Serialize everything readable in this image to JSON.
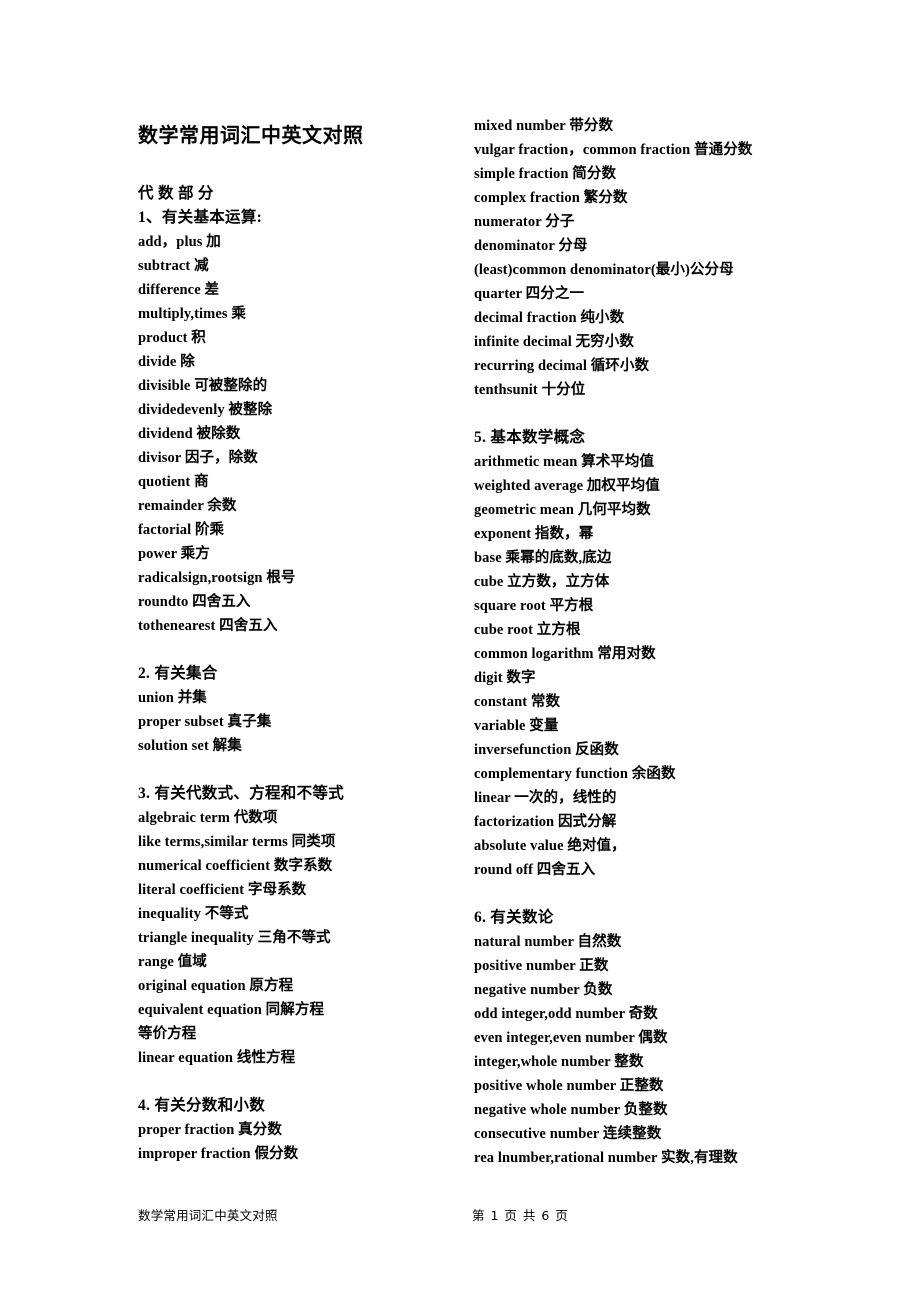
{
  "document": {
    "title": "数学常用词汇中英文对照"
  },
  "footer": {
    "left_text": "数学常用词汇中英文对照",
    "page_info": "第 1 页 共 6 页"
  },
  "left_column": [
    {
      "type": "partlabel",
      "text": "代 数 部 分"
    },
    {
      "type": "heading",
      "text": "1、有关基本运算:"
    },
    {
      "type": "entry",
      "text": "add，plus 加"
    },
    {
      "type": "entry",
      "text": "subtract 减"
    },
    {
      "type": "entry",
      "text": "difference 差"
    },
    {
      "type": "entry",
      "text": "multiply,times 乘"
    },
    {
      "type": "entry",
      "text": "product 积"
    },
    {
      "type": "entry",
      "text": "divide 除"
    },
    {
      "type": "entry",
      "text": "divisible 可被整除的"
    },
    {
      "type": "entry",
      "text": "dividedevenly 被整除"
    },
    {
      "type": "entry",
      "text": "dividend 被除数"
    },
    {
      "type": "entry",
      "text": "divisor 因子，除数"
    },
    {
      "type": "entry",
      "text": "quotient 商"
    },
    {
      "type": "entry",
      "text": "remainder 余数"
    },
    {
      "type": "entry",
      "text": "factorial 阶乘"
    },
    {
      "type": "entry",
      "text": "power 乘方"
    },
    {
      "type": "entry",
      "text": "radicalsign,rootsign 根号"
    },
    {
      "type": "entry",
      "text": "roundto 四舍五入"
    },
    {
      "type": "entry",
      "text": "tothenearest 四舍五入"
    },
    {
      "type": "blank",
      "text": ""
    },
    {
      "type": "heading",
      "text": "2. 有关集合"
    },
    {
      "type": "entry",
      "text": "union 并集"
    },
    {
      "type": "entry",
      "text": "proper subset 真子集"
    },
    {
      "type": "entry",
      "text": "solution set 解集"
    },
    {
      "type": "blank",
      "text": ""
    },
    {
      "type": "heading",
      "text": "3. 有关代数式、方程和不等式"
    },
    {
      "type": "entry",
      "text": "algebraic term 代数项"
    },
    {
      "type": "entry",
      "text": "like terms,similar terms 同类项"
    },
    {
      "type": "entry",
      "text": "numerical coefficient 数字系数"
    },
    {
      "type": "entry",
      "text": "literal coefficient 字母系数"
    },
    {
      "type": "entry",
      "text": "inequality 不等式"
    },
    {
      "type": "entry",
      "text": "triangle inequality 三角不等式"
    },
    {
      "type": "entry",
      "text": "range 值域"
    },
    {
      "type": "entry",
      "text": "original equation 原方程"
    },
    {
      "type": "entry",
      "text": "equivalent equation 同解方程"
    },
    {
      "type": "entry",
      "text": "等价方程"
    },
    {
      "type": "entry",
      "text": "linear equation 线性方程"
    },
    {
      "type": "blank",
      "text": ""
    },
    {
      "type": "heading",
      "text": "4. 有关分数和小数"
    },
    {
      "type": "entry",
      "text": "proper fraction 真分数"
    },
    {
      "type": "entry",
      "text": "improper fraction 假分数"
    }
  ],
  "right_column": [
    {
      "type": "entry",
      "text": "mixed number 带分数"
    },
    {
      "type": "entry",
      "text": "vulgar fraction，common fraction 普通分数"
    },
    {
      "type": "entry",
      "text": "simple fraction 简分数"
    },
    {
      "type": "entry",
      "text": "complex fraction 繁分数"
    },
    {
      "type": "entry",
      "text": "numerator 分子"
    },
    {
      "type": "entry",
      "text": "denominator 分母"
    },
    {
      "type": "entry",
      "text": "(least)common denominator(最小)公分母"
    },
    {
      "type": "entry",
      "text": "quarter 四分之一"
    },
    {
      "type": "entry",
      "text": "decimal fraction 纯小数"
    },
    {
      "type": "entry",
      "text": "infinite decimal 无穷小数"
    },
    {
      "type": "entry",
      "text": "recurring decimal 循环小数"
    },
    {
      "type": "entry",
      "text": "tenthsunit 十分位"
    },
    {
      "type": "blank",
      "text": ""
    },
    {
      "type": "heading",
      "text": "5. 基本数学概念"
    },
    {
      "type": "entry",
      "text": "arithmetic mean 算术平均值"
    },
    {
      "type": "entry",
      "text": "weighted average 加权平均值"
    },
    {
      "type": "entry",
      "text": "geometric mean 几何平均数"
    },
    {
      "type": "entry",
      "text": "exponent 指数，幂"
    },
    {
      "type": "entry",
      "text": "base 乘幂的底数,底边"
    },
    {
      "type": "entry",
      "text": "cube 立方数，立方体"
    },
    {
      "type": "entry",
      "text": "square root 平方根"
    },
    {
      "type": "entry",
      "text": "cube root 立方根"
    },
    {
      "type": "entry",
      "text": "common logarithm 常用对数"
    },
    {
      "type": "entry",
      "text": "digit 数字"
    },
    {
      "type": "entry",
      "text": "constant 常数"
    },
    {
      "type": "entry",
      "text": "variable 变量"
    },
    {
      "type": "entry",
      "text": "inversefunction 反函数"
    },
    {
      "type": "entry",
      "text": "complementary function 余函数"
    },
    {
      "type": "entry",
      "text": "linear 一次的，线性的"
    },
    {
      "type": "entry",
      "text": "factorization 因式分解"
    },
    {
      "type": "entry",
      "text": "absolute value 绝对值，"
    },
    {
      "type": "entry",
      "text": "round off 四舍五入"
    },
    {
      "type": "blank",
      "text": ""
    },
    {
      "type": "heading",
      "text": "6. 有关数论"
    },
    {
      "type": "entry",
      "text": "natural number 自然数"
    },
    {
      "type": "entry",
      "text": "positive number 正数"
    },
    {
      "type": "entry",
      "text": "negative number 负数"
    },
    {
      "type": "entry",
      "text": "odd integer,odd number 奇数"
    },
    {
      "type": "entry",
      "text": "even integer,even number 偶数"
    },
    {
      "type": "entry",
      "text": "integer,whole number 整数"
    },
    {
      "type": "entry",
      "text": "positive whole number 正整数"
    },
    {
      "type": "entry",
      "text": "negative whole number 负整数"
    },
    {
      "type": "entry",
      "text": "consecutive number 连续整数"
    },
    {
      "type": "entry",
      "text": "rea lnumber,rational number 实数,有理数"
    }
  ]
}
